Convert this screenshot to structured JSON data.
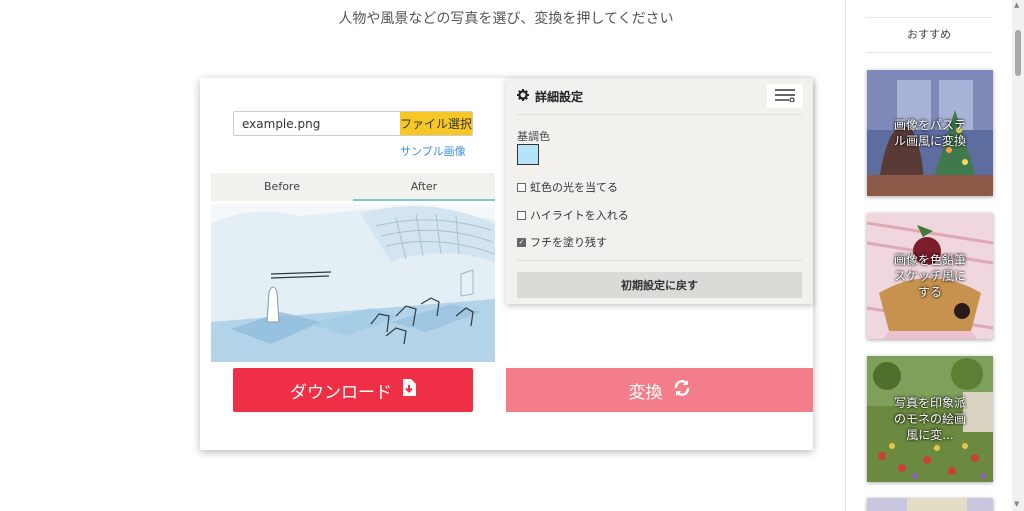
{
  "instruction": "人物や風景などの写真を選び、変換を押してください",
  "upload": {
    "filename": "example.png",
    "file_button": "ファイル選択",
    "sample_link": "サンプル画像"
  },
  "tabs": {
    "before": "Before",
    "after": "After",
    "active": "After"
  },
  "actions": {
    "download_label": "ダウンロード",
    "convert_label": "変換"
  },
  "settings": {
    "title": "詳細設定",
    "base_color_label": "基調色",
    "base_color": "#b5e3f7",
    "options": [
      {
        "label": "虹色の光を当てる",
        "checked": false
      },
      {
        "label": "ハイライトを入れる",
        "checked": false
      },
      {
        "label": "フチを塗り残す",
        "checked": true
      }
    ],
    "reset_label": "初期設定に戻す"
  },
  "sidebar": {
    "title": "おすすめ",
    "items": [
      {
        "label": "画像をパステル画風に変換"
      },
      {
        "label": "画像を色鉛筆スケッチ風にする"
      },
      {
        "label": "写真を印象派のモネの絵画風に変..."
      }
    ]
  },
  "colors": {
    "download": "#ee2f45",
    "convert": "#f37d88",
    "file_button": "#f7c825",
    "link": "#3b8ed8",
    "tab_underline": "#7ec8c8"
  }
}
